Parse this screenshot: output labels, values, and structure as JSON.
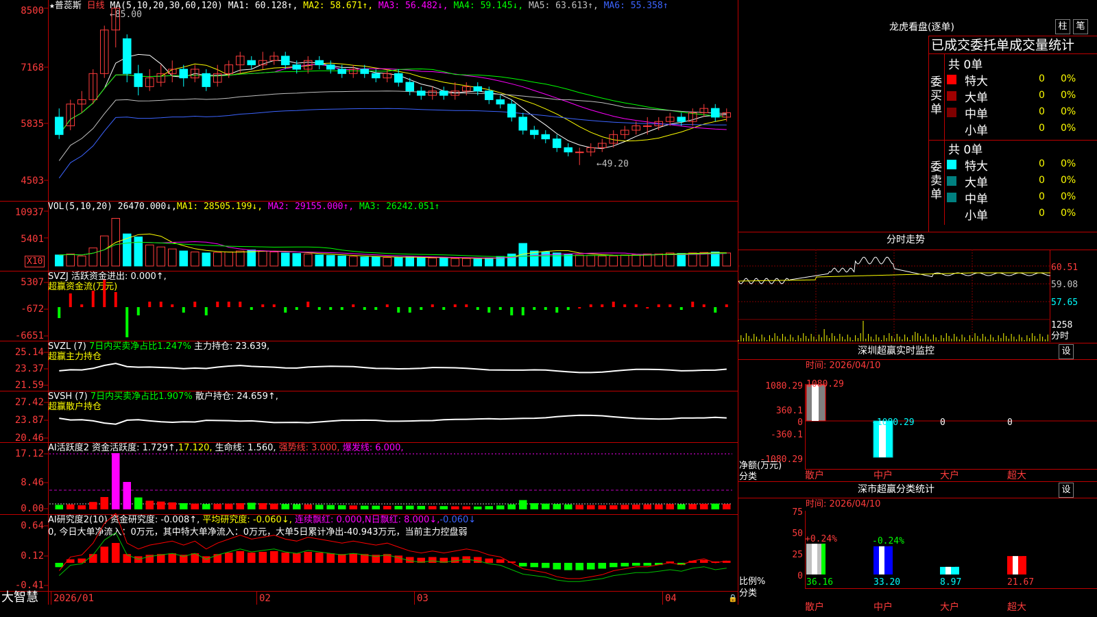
{
  "title_bar": {
    "star": "★",
    "stock_name": "普蕊斯",
    "period": "日线",
    "high_mark": "85.00",
    "low_mark": "49.20",
    "ma_label": "MA(5,10,20,30,60,120)",
    "ma1": "MA1: 60.128↑,",
    "ma2": "MA2: 58.671↑,",
    "ma3": "MA3: 56.482↓,",
    "ma4": "MA4: 59.145↓,",
    "ma5": "MA5: 63.613↑,",
    "ma6": "MA6: 55.358↑"
  },
  "price_axis": [
    "8500",
    "7168",
    "5835",
    "4503"
  ],
  "vol_panel": {
    "label": "VOL(5,10,20)",
    "vol": "26470.000↓,",
    "ma1": "MA1: 28505.199↓,",
    "ma2": "MA2: 29155.000↑,",
    "ma3": "MA3: 26242.051↑",
    "axis": [
      "10937",
      "5401"
    ],
    "unit": "X10"
  },
  "svzj_panel": {
    "line1": "SVZJ  活跃资金进出: 0.000↑,",
    "line2": "超赢资金流(万元)",
    "axis": [
      "5307",
      "-672",
      "-6651"
    ]
  },
  "svzl_panel": {
    "prefix": "SVZL (7) ",
    "green_text": "7日内买卖净占比1.247%",
    "tail": " 主力持仓: 23.639,",
    "line2": "超赢主力持仓",
    "axis": [
      "25.14",
      "23.37",
      "21.59"
    ]
  },
  "svsh_panel": {
    "prefix": "SVSH (7) ",
    "green_text": "7日内买卖净占比1.907%",
    "tail": " 散户持仓: 24.659↑,",
    "line2": "超赢散户持仓",
    "axis": [
      "27.42",
      "23.87",
      "20.46"
    ]
  },
  "ai_active_panel": {
    "t1": "AI活跃度2 资金活跃度: 1.729↑,",
    "t2": "17.120,",
    "t3": "生命线: 1.560,",
    "t4": "强势线: 3.000,",
    "t5": "爆发线: 6.000,",
    "axis": [
      "17.12",
      "8.46",
      "0.00"
    ]
  },
  "ai_research_panel": {
    "t1": "AI研究度2(10) 资金研究度: -0.008↑,",
    "t2": "平均研究度: -0.060↓,",
    "t3": "连续飘红: 0.000,",
    "t4": "N日飘红: 8.000↓,",
    "t5": "-0.060↓",
    "summary": "0, 今日大单净流入：0万元，其中特大单净流入：0万元，大单5日累计净出-40.943万元，当前主力控盘弱",
    "axis": [
      "0.64",
      "0.12",
      "-0.41"
    ]
  },
  "date_axis": [
    "2026/01",
    "02",
    "03",
    "04"
  ],
  "brand": "大智慧",
  "right_panel": {
    "lhb_title": "龙虎看盘(逐单)",
    "btn_zhu": "柱",
    "btn_bi": "笔",
    "tabs": "已成交委托单成交量统计",
    "buy_label": "委买单",
    "sell_label": "委卖单",
    "buy_total": "共 0单",
    "sell_total": "共 0单",
    "buy_rows": [
      {
        "name": "特大",
        "count": "0",
        "pct": "0%",
        "color": "#ff0000"
      },
      {
        "name": "大单",
        "count": "0",
        "pct": "0%",
        "color": "#a00000"
      },
      {
        "name": "中单",
        "count": "0",
        "pct": "0%",
        "color": "#800000"
      },
      {
        "name": "小单",
        "count": "0",
        "pct": "0%",
        "color": ""
      }
    ],
    "sell_rows": [
      {
        "name": "特大",
        "count": "0",
        "pct": "0%",
        "color": "#00ffff"
      },
      {
        "name": "大单",
        "count": "0",
        "pct": "0%",
        "color": "#008080"
      },
      {
        "name": "中单",
        "count": "0",
        "pct": "0%",
        "color": "#008080"
      },
      {
        "name": "小单",
        "count": "0",
        "pct": "0%",
        "color": ""
      }
    ],
    "fenshi_title": "分时走势",
    "fenshi_axis": [
      "60.51",
      "59.08",
      "57.65"
    ],
    "fenshi_vol": "1258",
    "fenshi_label": "分时",
    "monitor_title": "深圳超赢实时监控",
    "monitor_btn": "设",
    "monitor_time": "时间: 2026/04/10",
    "monitor_axis": [
      "1080.29",
      "360.1",
      "0",
      "-360.1",
      "-1080.29"
    ],
    "monitor_values": [
      "1080.29",
      "-1080.29",
      "0",
      "0"
    ],
    "monitor_ylabel": "净额(万元)",
    "monitor_xlabel": "分类",
    "monitor_cats": [
      "散户",
      "中户",
      "大户",
      "超大"
    ],
    "stat_title": "深市超赢分类统计",
    "stat_btn": "设",
    "stat_time": "时间: 2026/04/10",
    "stat_axis": [
      "75",
      "50",
      "25",
      "0"
    ],
    "stat_pct_labels": [
      "+0.24%",
      "-0.24%"
    ],
    "stat_values": [
      "36.16",
      "33.20",
      "8.97",
      "21.67"
    ],
    "stat_ylabel": "比例%",
    "stat_xlabel": "分类",
    "stat_cats": [
      "散户",
      "中户",
      "大户",
      "超大"
    ]
  },
  "chart_data": {
    "type": "candlestick",
    "candles": [
      [
        60,
        56,
        62,
        55
      ],
      [
        58,
        63,
        64,
        57
      ],
      [
        63,
        64,
        66,
        61
      ],
      [
        64,
        70,
        71,
        63
      ],
      [
        70,
        80,
        81,
        69
      ],
      [
        80,
        85,
        85,
        76
      ],
      [
        78,
        70,
        79,
        68
      ],
      [
        70,
        67,
        72,
        65
      ],
      [
        67,
        69,
        71,
        66
      ],
      [
        68,
        70,
        72,
        67
      ],
      [
        70,
        71,
        73,
        68
      ],
      [
        71,
        69,
        72,
        67
      ],
      [
        69,
        71,
        72,
        68
      ],
      [
        70,
        67,
        71,
        66
      ],
      [
        68,
        70,
        72,
        67
      ],
      [
        70,
        72,
        73,
        69
      ],
      [
        72,
        74,
        75,
        70
      ],
      [
        73,
        72,
        74,
        71
      ],
      [
        72,
        73,
        75,
        71
      ],
      [
        73,
        74,
        75,
        72
      ],
      [
        74,
        72,
        75,
        71
      ],
      [
        72,
        71,
        73,
        70
      ],
      [
        71,
        73,
        74,
        70
      ],
      [
        73,
        72,
        74,
        71
      ],
      [
        72,
        71,
        73,
        70
      ],
      [
        71,
        70,
        72,
        69
      ],
      [
        70,
        71,
        72,
        69
      ],
      [
        71,
        70,
        72,
        69
      ],
      [
        70,
        69,
        71,
        68
      ],
      [
        69,
        70,
        71,
        68
      ],
      [
        70,
        68,
        71,
        67
      ],
      [
        68,
        66,
        69,
        65
      ],
      [
        66,
        65,
        67,
        64
      ],
      [
        65,
        66,
        67,
        64
      ],
      [
        66,
        65,
        67,
        64
      ],
      [
        65,
        66,
        68,
        64
      ],
      [
        66,
        67,
        68,
        65
      ],
      [
        67,
        66,
        68,
        65
      ],
      [
        66,
        64,
        67,
        63
      ],
      [
        64,
        63,
        65,
        62
      ],
      [
        63,
        60,
        64,
        59
      ],
      [
        60,
        57,
        61,
        56
      ],
      [
        57,
        56,
        58,
        55
      ],
      [
        56,
        55,
        57,
        54
      ],
      [
        55,
        53,
        56,
        52
      ],
      [
        53,
        52,
        54,
        51
      ],
      [
        52,
        52,
        53,
        49
      ],
      [
        52,
        53,
        54,
        51
      ],
      [
        53,
        54,
        55,
        52
      ],
      [
        54,
        56,
        57,
        53
      ],
      [
        56,
        57,
        58,
        55
      ],
      [
        57,
        58,
        59,
        56
      ],
      [
        58,
        58,
        60,
        56
      ],
      [
        58,
        59,
        60,
        57
      ],
      [
        59,
        60,
        61,
        58
      ],
      [
        60,
        59,
        61,
        58
      ],
      [
        59,
        61,
        62,
        58
      ],
      [
        61,
        62,
        63,
        60
      ],
      [
        62,
        60,
        63,
        59
      ],
      [
        60,
        61,
        62,
        59
      ]
    ],
    "volume": [
      22,
      24,
      20,
      36,
      60,
      95,
      64,
      58,
      42,
      38,
      34,
      30,
      28,
      26,
      27,
      28,
      30,
      32,
      30,
      28,
      26,
      25,
      24,
      22,
      21,
      20,
      19,
      18,
      18,
      17,
      17,
      18,
      17,
      16,
      16,
      15,
      15,
      14,
      16,
      19,
      24,
      45,
      30,
      28,
      26,
      24,
      22,
      21,
      20,
      20,
      22,
      23,
      24,
      24,
      26,
      25,
      26,
      27,
      28,
      26
    ],
    "price_ylim": [
      45.03,
      85.0
    ],
    "vol_ylim": [
      0,
      109.37
    ],
    "date_ticks": [
      "2026/01",
      "02",
      "03",
      "04"
    ]
  }
}
